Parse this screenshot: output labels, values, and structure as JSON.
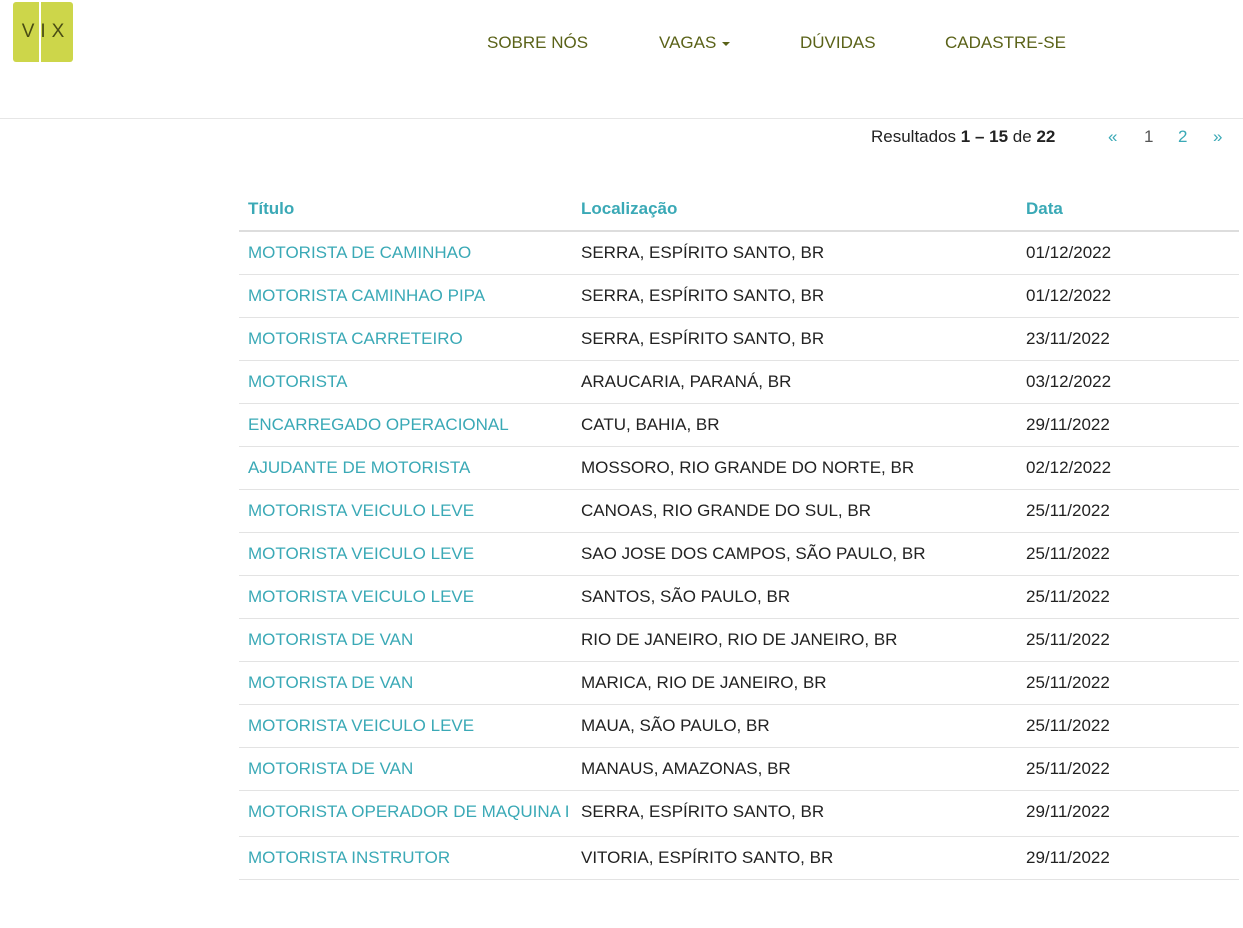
{
  "logo": {
    "text": "VIX",
    "color": "#cdd64a"
  },
  "nav": {
    "items": [
      {
        "label": "SOBRE NÓS"
      },
      {
        "label": "VAGAS"
      },
      {
        "label": "DÚVIDAS"
      },
      {
        "label": "CADASTRE-SE"
      }
    ],
    "color": "#5a6218"
  },
  "results": {
    "prefix": "Resultados",
    "range": "1 – 15",
    "of": "de",
    "total": "22"
  },
  "pagination": {
    "prev": "«",
    "pages": [
      "1",
      "2"
    ],
    "current": "1",
    "next": "»"
  },
  "table": {
    "headers": {
      "title": "Título",
      "location": "Localização",
      "date": "Data"
    },
    "accent": "#3aa9b6",
    "rows": [
      {
        "title": "MOTORISTA DE CAMINHAO",
        "location": "SERRA, ESPÍRITO SANTO, BR",
        "date": "01/12/2022"
      },
      {
        "title": "MOTORISTA CAMINHAO PIPA",
        "location": "SERRA, ESPÍRITO SANTO, BR",
        "date": "01/12/2022"
      },
      {
        "title": "MOTORISTA CARRETEIRO",
        "location": "SERRA, ESPÍRITO SANTO, BR",
        "date": "23/11/2022"
      },
      {
        "title": "MOTORISTA",
        "location": "ARAUCARIA, PARANÁ, BR",
        "date": "03/12/2022"
      },
      {
        "title": "ENCARREGADO OPERACIONAL",
        "location": "CATU, BAHIA, BR",
        "date": "29/11/2022"
      },
      {
        "title": "AJUDANTE DE MOTORISTA",
        "location": "MOSSORO, RIO GRANDE DO NORTE, BR",
        "date": "02/12/2022"
      },
      {
        "title": "MOTORISTA VEICULO LEVE",
        "location": "CANOAS, RIO GRANDE DO SUL, BR",
        "date": "25/11/2022"
      },
      {
        "title": "MOTORISTA VEICULO LEVE",
        "location": "SAO JOSE DOS CAMPOS, SÃO PAULO, BR",
        "date": "25/11/2022"
      },
      {
        "title": "MOTORISTA VEICULO LEVE",
        "location": "SANTOS, SÃO PAULO, BR",
        "date": "25/11/2022"
      },
      {
        "title": "MOTORISTA DE VAN",
        "location": "RIO DE JANEIRO, RIO DE JANEIRO, BR",
        "date": "25/11/2022"
      },
      {
        "title": "MOTORISTA DE VAN",
        "location": "MARICA, RIO DE JANEIRO, BR",
        "date": "25/11/2022"
      },
      {
        "title": "MOTORISTA VEICULO LEVE",
        "location": "MAUA, SÃO PAULO, BR",
        "date": "25/11/2022"
      },
      {
        "title": "MOTORISTA DE VAN",
        "location": "MANAUS, AMAZONAS, BR",
        "date": "25/11/2022"
      },
      {
        "title": "MOTORISTA OPERADOR DE MAQUINA I",
        "location": "SERRA, ESPÍRITO SANTO, BR",
        "date": "29/11/2022"
      },
      {
        "title": "MOTORISTA INSTRUTOR",
        "location": "VITORIA, ESPÍRITO SANTO, BR",
        "date": "29/11/2022"
      }
    ]
  }
}
